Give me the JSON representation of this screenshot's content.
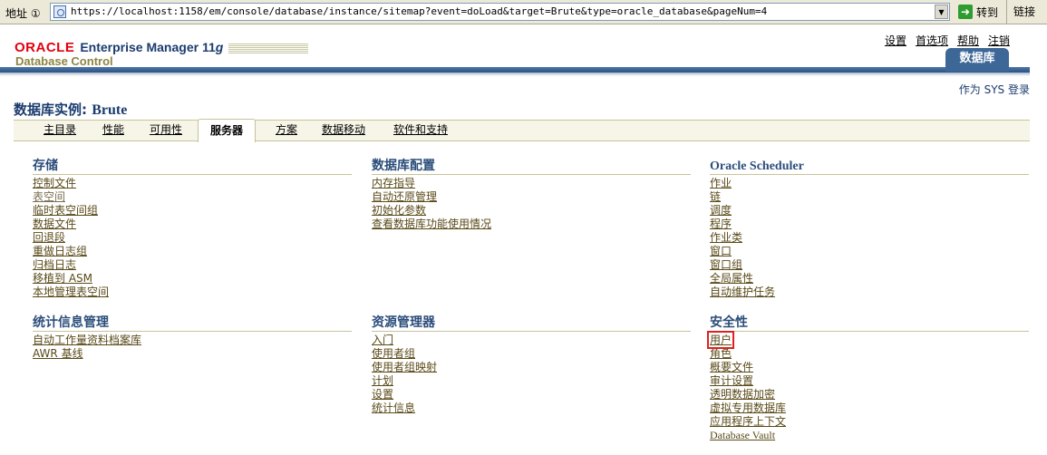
{
  "browser": {
    "address_label": "地址 ①",
    "url": "https://localhost:1158/em/console/database/instance/sitemap?event=doLoad&target=Brute&type=oracle_database&pageNum=4",
    "go_label": "转到",
    "links_label": "链接"
  },
  "header": {
    "oracle": "ORACLE",
    "product": "Enterprise Manager 11",
    "version_letter": "g",
    "subtitle": "Database Control",
    "global_links": [
      "设置",
      "首选项",
      "帮助",
      "注销"
    ],
    "db_tab": "数据库",
    "login_as": "作为 SYS 登录"
  },
  "page": {
    "title_prefix": "数据库实例: ",
    "instance": "Brute"
  },
  "subtabs": [
    "主目录",
    "性能",
    "可用性",
    "服务器",
    "方案",
    "数据移动",
    "软件和支持"
  ],
  "sections": {
    "storage": {
      "title": "存储",
      "items": [
        "控制文件",
        "表空间",
        "临时表空间组",
        "数据文件",
        "回退段",
        "重做日志组",
        "归档日志",
        "移植到 ASM",
        "本地管理表空间"
      ]
    },
    "dbconfig": {
      "title": "数据库配置",
      "items": [
        "内存指导",
        "自动还原管理",
        "初始化参数",
        "查看数据库功能使用情况"
      ]
    },
    "scheduler": {
      "title": "Oracle Scheduler",
      "items": [
        "作业",
        "链",
        "调度",
        "程序",
        "作业类",
        "窗口",
        "窗口组",
        "全局属性",
        "自动维护任务"
      ]
    },
    "stats": {
      "title": "统计信息管理",
      "items": [
        "自动工作量资料档案库",
        "AWR 基线"
      ]
    },
    "resource": {
      "title": "资源管理器",
      "items": [
        "入门",
        "使用者组",
        "使用者组映射",
        "计划",
        "设置",
        "统计信息"
      ]
    },
    "security": {
      "title": "安全性",
      "items": [
        "用户",
        "角色",
        "概要文件",
        "审计设置",
        "透明数据加密",
        "虚拟专用数据库",
        "应用程序上下文",
        "Database Vault"
      ]
    }
  },
  "colors": {
    "accent": "#3d6797",
    "oracle_red": "#e3000f",
    "link": "#5a4a18",
    "highlight": "#e02020"
  }
}
